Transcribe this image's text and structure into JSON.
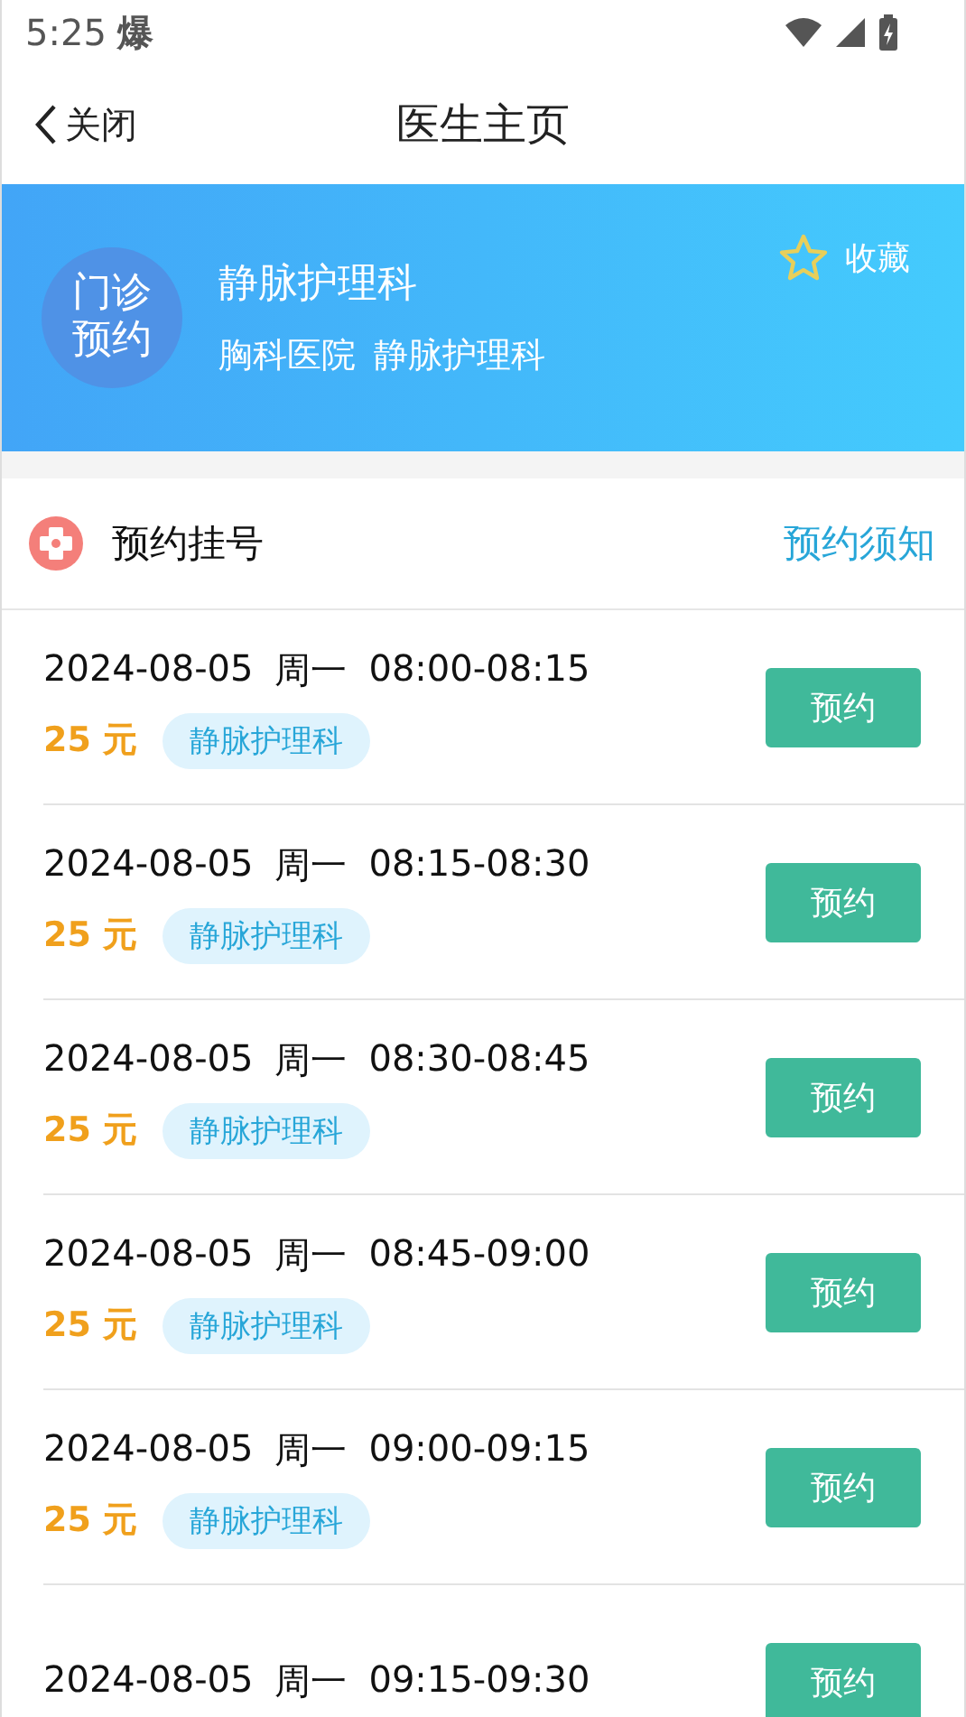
{
  "status_bar": {
    "time": "5:25",
    "notification": "爆"
  },
  "nav": {
    "back": "关闭",
    "title": "医生主页"
  },
  "doctor": {
    "avatar_text": "门诊预约",
    "name": "静脉护理科",
    "hospital": "胸科医院",
    "department": "静脉护理科",
    "favorite": {
      "label": "收藏",
      "on": false
    }
  },
  "section": {
    "title": "预约挂号",
    "link": "预约须知"
  },
  "slots": [
    {
      "date": "2024-08-05",
      "weekday": "周一",
      "time": "08:00-08:15",
      "price": "25 元",
      "tag": "静脉护理科",
      "button": "预约"
    },
    {
      "date": "2024-08-05",
      "weekday": "周一",
      "time": "08:15-08:30",
      "price": "25 元",
      "tag": "静脉护理科",
      "button": "预约"
    },
    {
      "date": "2024-08-05",
      "weekday": "周一",
      "time": "08:30-08:45",
      "price": "25 元",
      "tag": "静脉护理科",
      "button": "预约"
    },
    {
      "date": "2024-08-05",
      "weekday": "周一",
      "time": "08:45-09:00",
      "price": "25 元",
      "tag": "静脉护理科",
      "button": "预约"
    },
    {
      "date": "2024-08-05",
      "weekday": "周一",
      "time": "09:00-09:15",
      "price": "25 元",
      "tag": "静脉护理科",
      "button": "预约"
    },
    {
      "date": "2024-08-05",
      "weekday": "周一",
      "time": "09:15-09:30",
      "button": "预约"
    }
  ]
}
